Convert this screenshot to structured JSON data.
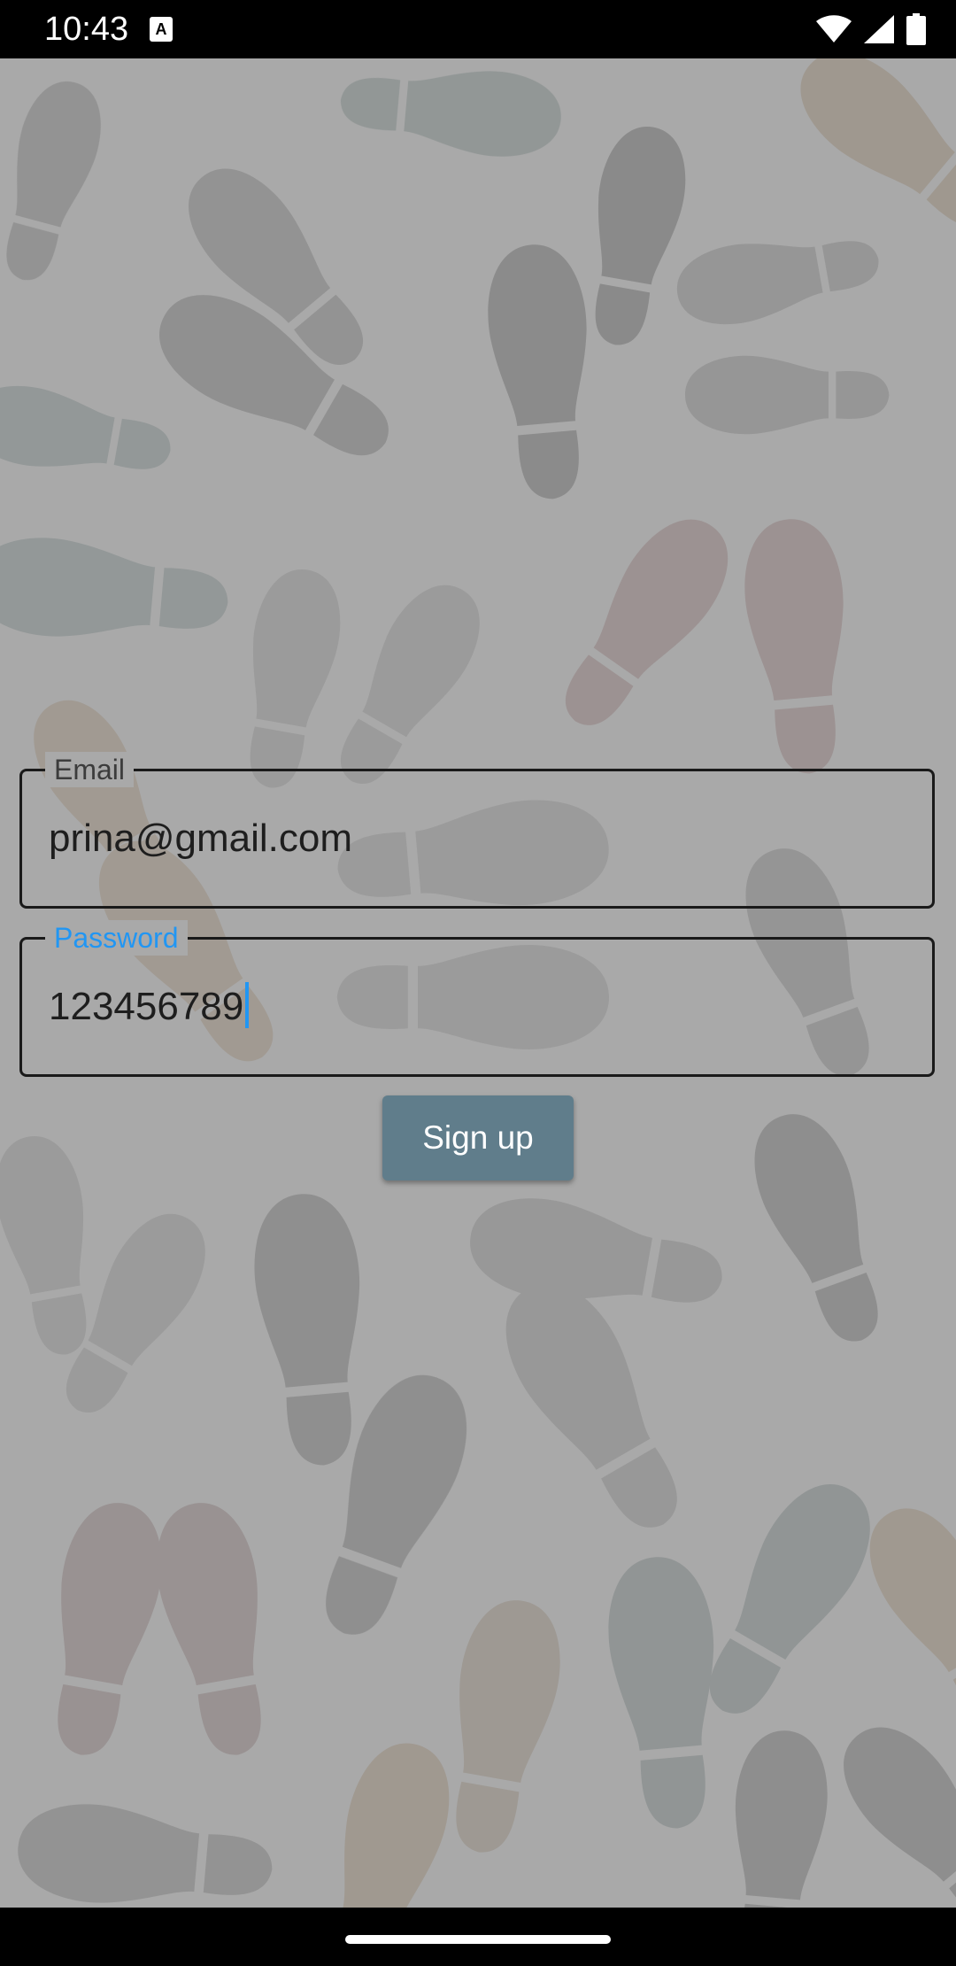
{
  "status_bar": {
    "time": "10:43",
    "icons": [
      "text-notification-icon",
      "wifi-icon",
      "signal-icon",
      "battery-icon"
    ]
  },
  "background": {
    "description_icon": "shoe-prints-pattern",
    "base_color": "#a9a9a9"
  },
  "form": {
    "email": {
      "label": "Email",
      "value": "prina@gmail.com"
    },
    "password": {
      "label": "Password",
      "value": "123456789"
    },
    "signup_label": "Sign up"
  },
  "colors": {
    "accent": "#2196f3",
    "button": "#607d8b",
    "border": "#1a1a1a"
  },
  "nav_bar": {
    "icons": [
      "home-handle"
    ]
  }
}
